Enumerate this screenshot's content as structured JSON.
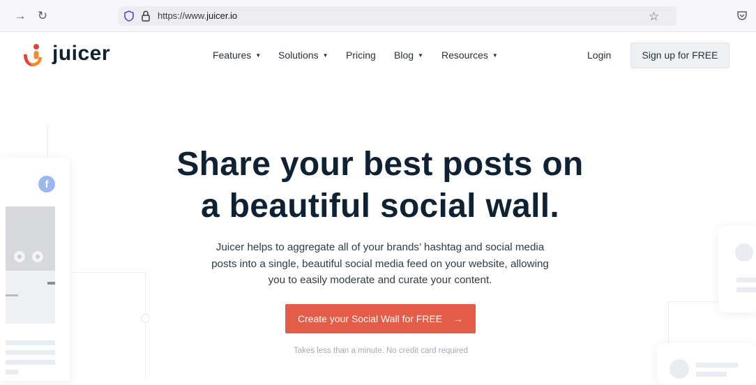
{
  "browser": {
    "url_prefix": "https://www.",
    "url_host": "juicer.io",
    "icons": [
      "forward-arrow-icon",
      "reload-icon",
      "tracking-shield-icon",
      "lock-icon",
      "bookmark-star-icon",
      "pocket-icon"
    ]
  },
  "header": {
    "logo_text": "juicer",
    "nav": [
      {
        "label": "Features",
        "dropdown": true
      },
      {
        "label": "Solutions",
        "dropdown": true
      },
      {
        "label": "Pricing",
        "dropdown": false
      },
      {
        "label": "Blog",
        "dropdown": true
      },
      {
        "label": "Resources",
        "dropdown": true
      }
    ],
    "login_label": "Login",
    "signup_label": "Sign up for FREE"
  },
  "hero": {
    "title_line1": "Share your best posts on",
    "title_line2": "a beautiful social wall.",
    "body_line1": "Juicer helps to aggregate all of your brands’ hashtag and social media",
    "body_line2": "posts into a single, beautiful social media feed on your website, allowing",
    "body_line3": "you to easily moderate and curate your content.",
    "cta_label": "Create your Social Wall for FREE",
    "cta_arrow": "→",
    "cta_note": "Takes less than a minute. No credit card required"
  },
  "colors": {
    "brand_dark": "#0f2233",
    "cta": "#e35d49",
    "logo_orange": "#f38a2e",
    "logo_red": "#e3453d",
    "facebook": "#9bb7ee"
  }
}
